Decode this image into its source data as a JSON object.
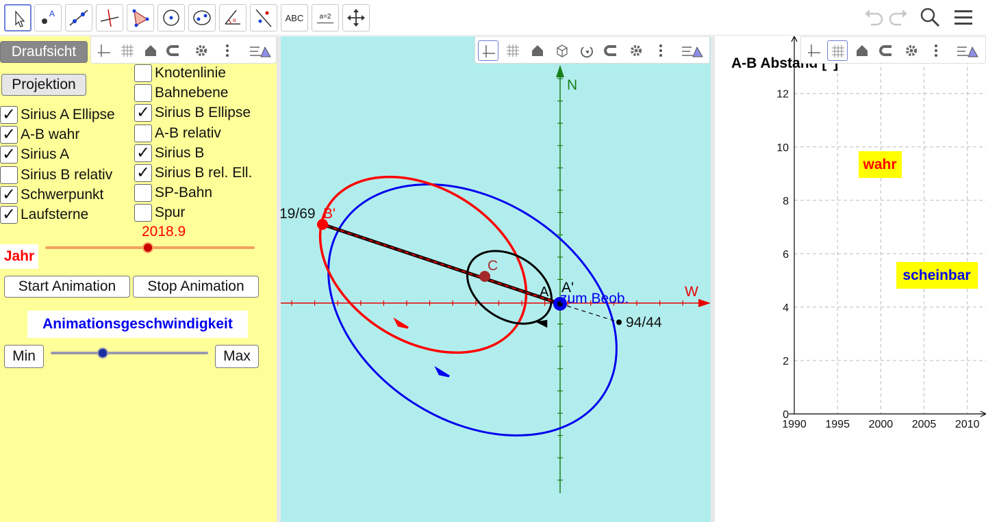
{
  "toolbar": {
    "tools": [
      {
        "name": "move-tool",
        "icon": "arrow-icon"
      },
      {
        "name": "point-tool",
        "icon": "point-icon"
      },
      {
        "name": "line-tool",
        "icon": "line-icon"
      },
      {
        "name": "perpendicular-tool",
        "icon": "perpendicular-icon"
      },
      {
        "name": "polygon-tool",
        "icon": "polygon-icon"
      },
      {
        "name": "circle-tool",
        "icon": "circle-icon"
      },
      {
        "name": "conic-tool",
        "icon": "ellipse-icon"
      },
      {
        "name": "angle-tool",
        "icon": "angle-icon"
      },
      {
        "name": "reflect-tool",
        "icon": "reflect-icon"
      },
      {
        "name": "text-tool",
        "icon": "text-icon",
        "label": "ABC"
      },
      {
        "name": "slider-tool",
        "icon": "slider-icon",
        "label": "a=2"
      },
      {
        "name": "move-view-tool",
        "icon": "move-graphics-icon"
      }
    ],
    "right": [
      "undo-icon",
      "redo-icon",
      "search-icon",
      "menu-icon"
    ]
  },
  "left_panel": {
    "view_buttons": {
      "top": "Draufsicht",
      "projection": "Projektion"
    },
    "checkboxes_left": [
      {
        "label": "Sirius A Ellipse",
        "checked": true
      },
      {
        "label": "A-B wahr",
        "checked": true
      },
      {
        "label": "Sirius A",
        "checked": true
      },
      {
        "label": "Sirius B relativ",
        "checked": false
      },
      {
        "label": "Schwerpunkt",
        "checked": true
      },
      {
        "label": "Laufsterne",
        "checked": true
      }
    ],
    "checkboxes_right": [
      {
        "label": "Knotenlinie",
        "checked": false
      },
      {
        "label": "Bahnebene",
        "checked": false
      },
      {
        "label": "Sirius B Ellipse",
        "checked": true
      },
      {
        "label": "A-B relativ",
        "checked": false
      },
      {
        "label": "Sirius B",
        "checked": true
      },
      {
        "label": "Sirius B rel. Ell.",
        "checked": true
      },
      {
        "label": "SP-Bahn",
        "checked": false
      },
      {
        "label": "Spur",
        "checked": false
      }
    ],
    "year_slider": {
      "label": "Jahr",
      "value": "2018.9",
      "fraction": 0.49,
      "color": "#ff0000"
    },
    "animation": {
      "start": "Start Animation",
      "stop": "Stop Animation"
    },
    "speed": {
      "label": "Animationsgeschwindigkeit",
      "min": "Min",
      "max": "Max",
      "fraction": 0.33
    }
  },
  "graphics": {
    "background": "#b2eded",
    "axis_labels": {
      "north": "N",
      "west": "W"
    },
    "points": {
      "b_label": "B'",
      "b_coord": "19/69",
      "c": "C",
      "a": "A",
      "a_prime": "A'",
      "observer": "zum Beob.",
      "far_coord": "94/44"
    },
    "colors": {
      "sirius_b": "#ff0000",
      "relative": "#0000ff",
      "sirius_a": "#000000",
      "center": "#a52a2a"
    }
  },
  "plot": {
    "chart_data": {
      "type": "line",
      "title": "A-B Abstand [\"]",
      "x_ticks": [
        "1990",
        "1995",
        "2000",
        "2005",
        "2010"
      ],
      "y_ticks": [
        "0",
        "2",
        "4",
        "6",
        "8",
        "10",
        "12"
      ],
      "xlim": [
        1990,
        2012
      ],
      "ylim": [
        0,
        12.3
      ],
      "grid": true,
      "series": [
        {
          "name": "wahr",
          "color": "#ff0000",
          "values": []
        },
        {
          "name": "scheinbar",
          "color": "#0000ff",
          "values": []
        }
      ]
    },
    "legend": {
      "true_label": "wahr",
      "apparent_label": "scheinbar",
      "highlight": "#ffff00"
    }
  }
}
